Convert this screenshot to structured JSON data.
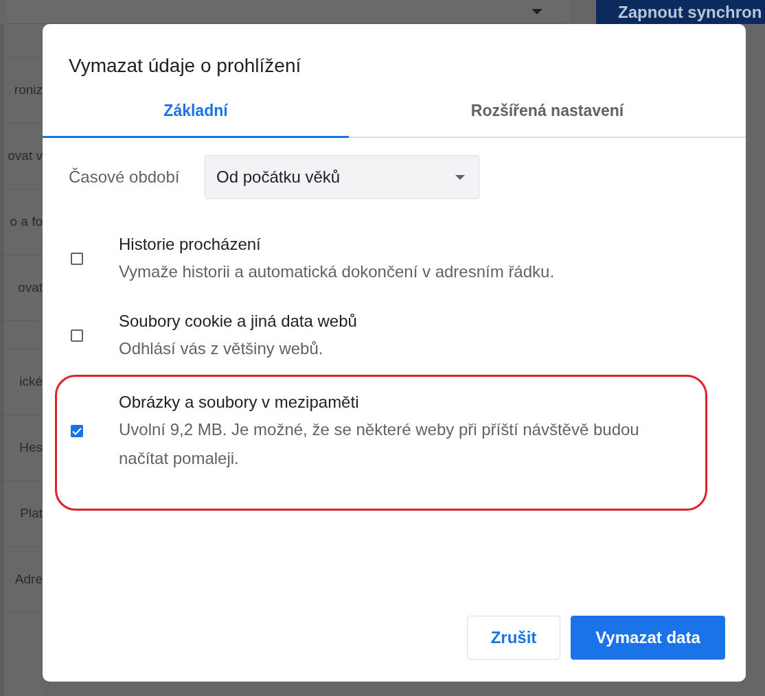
{
  "background": {
    "sync_button": "Zapnout synchron",
    "menu_groups": [
      [
        "roniz",
        "ovat v",
        "o a fo",
        "ovat"
      ],
      [
        "ické",
        "Hes",
        "Plat",
        "Adre"
      ]
    ]
  },
  "dialog": {
    "title": "Vymazat údaje o prohlížení",
    "tabs": [
      {
        "label": "Základní",
        "selected": true
      },
      {
        "label": "Rozšířená nastavení",
        "selected": false
      }
    ],
    "time_range": {
      "label": "Časové období",
      "value": "Od počátku věků"
    },
    "items": [
      {
        "title": "Historie procházení",
        "description": "Vymaže historii a automatická dokončení v adresním řádku.",
        "checked": false,
        "highlighted": false
      },
      {
        "title": "Soubory cookie a jiná data webů",
        "description": "Odhlásí vás z většiny webů.",
        "checked": false,
        "highlighted": false
      },
      {
        "title": "Obrázky a soubory v mezipaměti",
        "description": "Uvolní 9,2 MB. Je možné, že se některé weby při příští návštěvě budou načítat pomaleji.",
        "checked": true,
        "highlighted": true
      }
    ],
    "buttons": [
      {
        "label": "Zrušit",
        "kind": "secondary"
      },
      {
        "label": "Vymazat data",
        "kind": "primary"
      }
    ]
  }
}
